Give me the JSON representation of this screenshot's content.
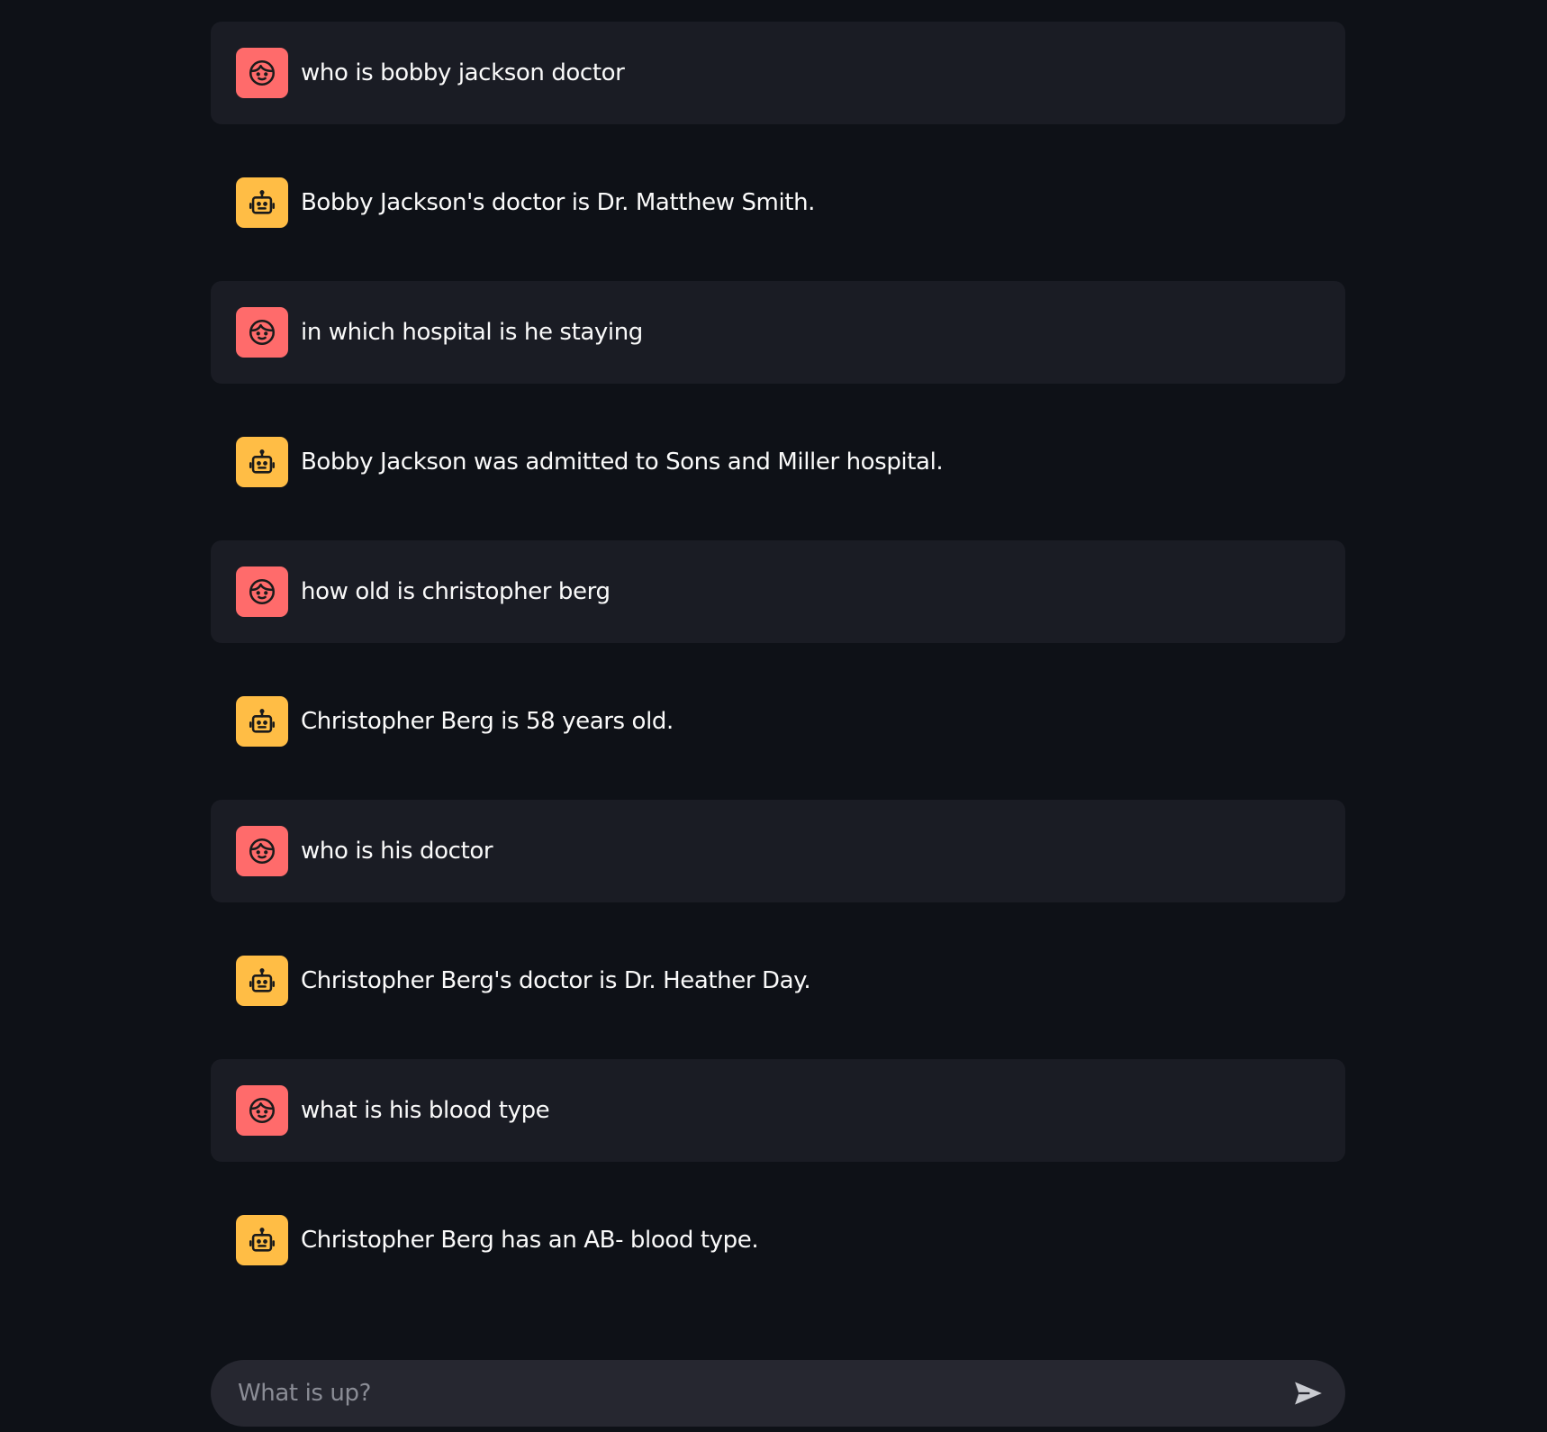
{
  "messages": [
    {
      "role": "user",
      "icon": "user-face-icon",
      "text": "who is bobby jackson doctor"
    },
    {
      "role": "assistant",
      "icon": "robot-icon",
      "text": "Bobby Jackson's doctor is Dr. Matthew Smith."
    },
    {
      "role": "user",
      "icon": "user-face-icon",
      "text": "in which hospital is he staying"
    },
    {
      "role": "assistant",
      "icon": "robot-icon",
      "text": "Bobby Jackson was admitted to Sons and Miller hospital."
    },
    {
      "role": "user",
      "icon": "user-face-icon",
      "text": "how old is christopher berg"
    },
    {
      "role": "assistant",
      "icon": "robot-icon",
      "text": "Christopher Berg is 58 years old."
    },
    {
      "role": "user",
      "icon": "user-face-icon",
      "text": "who is his doctor"
    },
    {
      "role": "assistant",
      "icon": "robot-icon",
      "text": "Christopher Berg's doctor is Dr. Heather Day."
    },
    {
      "role": "user",
      "icon": "user-face-icon",
      "text": "what is his blood type"
    },
    {
      "role": "assistant",
      "icon": "robot-icon",
      "text": "Christopher Berg has an AB- blood type."
    }
  ],
  "input": {
    "placeholder": "What is up?",
    "value": "",
    "send_icon": "send-icon"
  },
  "colors": {
    "background": "#0e1117",
    "user_message_bg": "#1a1c24",
    "user_avatar": "#ff6b6b",
    "assistant_avatar": "#ffbd45",
    "input_bg": "#262730",
    "text": "#fafafa",
    "placeholder": "#8b8d96"
  }
}
